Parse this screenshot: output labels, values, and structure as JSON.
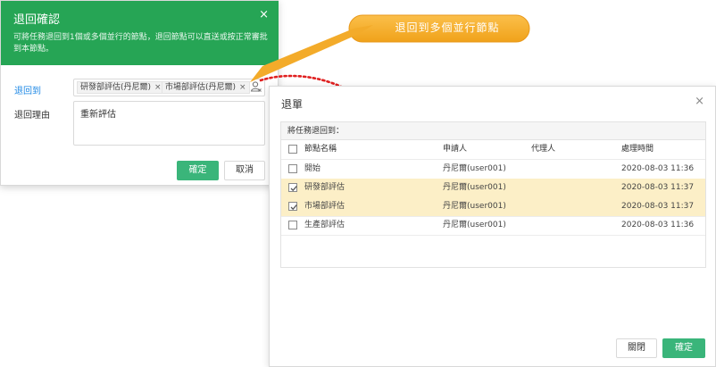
{
  "confirm_dialog": {
    "title": "退回確認",
    "close": "×",
    "description": "可將任務退回到1個或多個並行的節點，退回節點可以直送或按正常審批到本節點。",
    "return_to_label": "退回到",
    "tags": [
      {
        "label": "研發部評估(丹尼爾)",
        "remove": "×"
      },
      {
        "label": "市場部評估(丹尼爾)",
        "remove": "×"
      }
    ],
    "reason_label": "退回理由",
    "reason_value": "重新評估",
    "ok_label": "確定",
    "cancel_label": "取消"
  },
  "callout": {
    "text": "退回到多個並行節點"
  },
  "return_sheet": {
    "title": "退單",
    "close": "×",
    "panel_title": "將任務退回到：",
    "columns": [
      "節點名稱",
      "申請人",
      "代理人",
      "處理時間"
    ],
    "rows": [
      {
        "name": "開始",
        "applicant": "丹尼爾(user001)",
        "agent": "",
        "time": "2020-08-03 11:36",
        "checked": false
      },
      {
        "name": "研發部評估",
        "applicant": "丹尼爾(user001)",
        "agent": "",
        "time": "2020-08-03 11:37",
        "checked": true
      },
      {
        "name": "市場部評估",
        "applicant": "丹尼爾(user001)",
        "agent": "",
        "time": "2020-08-03 11:37",
        "checked": true
      },
      {
        "name": "生產部評估",
        "applicant": "丹尼爾(user001)",
        "agent": "",
        "time": "2020-08-03 11:36",
        "checked": false
      }
    ],
    "close_label": "關閉",
    "ok_label": "確定"
  },
  "colors": {
    "header_green": "#26a555",
    "button_green": "#3ab57a",
    "callout_orange": "#f5a623",
    "selected_row": "#fcefc7",
    "link_blue": "#1e88e5",
    "arrow_red": "#e02020"
  }
}
